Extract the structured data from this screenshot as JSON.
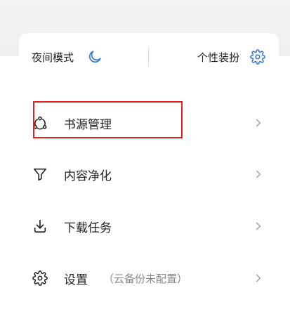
{
  "quick_actions": {
    "night_mode_label": "夜间模式",
    "theme_label": "个性装扮"
  },
  "menu": {
    "items": [
      {
        "label": "书源管理",
        "icon": "source-network-icon"
      },
      {
        "label": "内容净化",
        "icon": "filter-funnel-icon"
      },
      {
        "label": "下载任务",
        "icon": "download-icon"
      },
      {
        "label": "设置",
        "icon": "gear-icon",
        "hint": "（云备份未配置）"
      }
    ]
  },
  "colors": {
    "accent_blue": "#3a7bd5",
    "highlight_red": "#e02020",
    "text": "#222222",
    "hint": "#888888",
    "chevron": "#9a9a9a"
  }
}
